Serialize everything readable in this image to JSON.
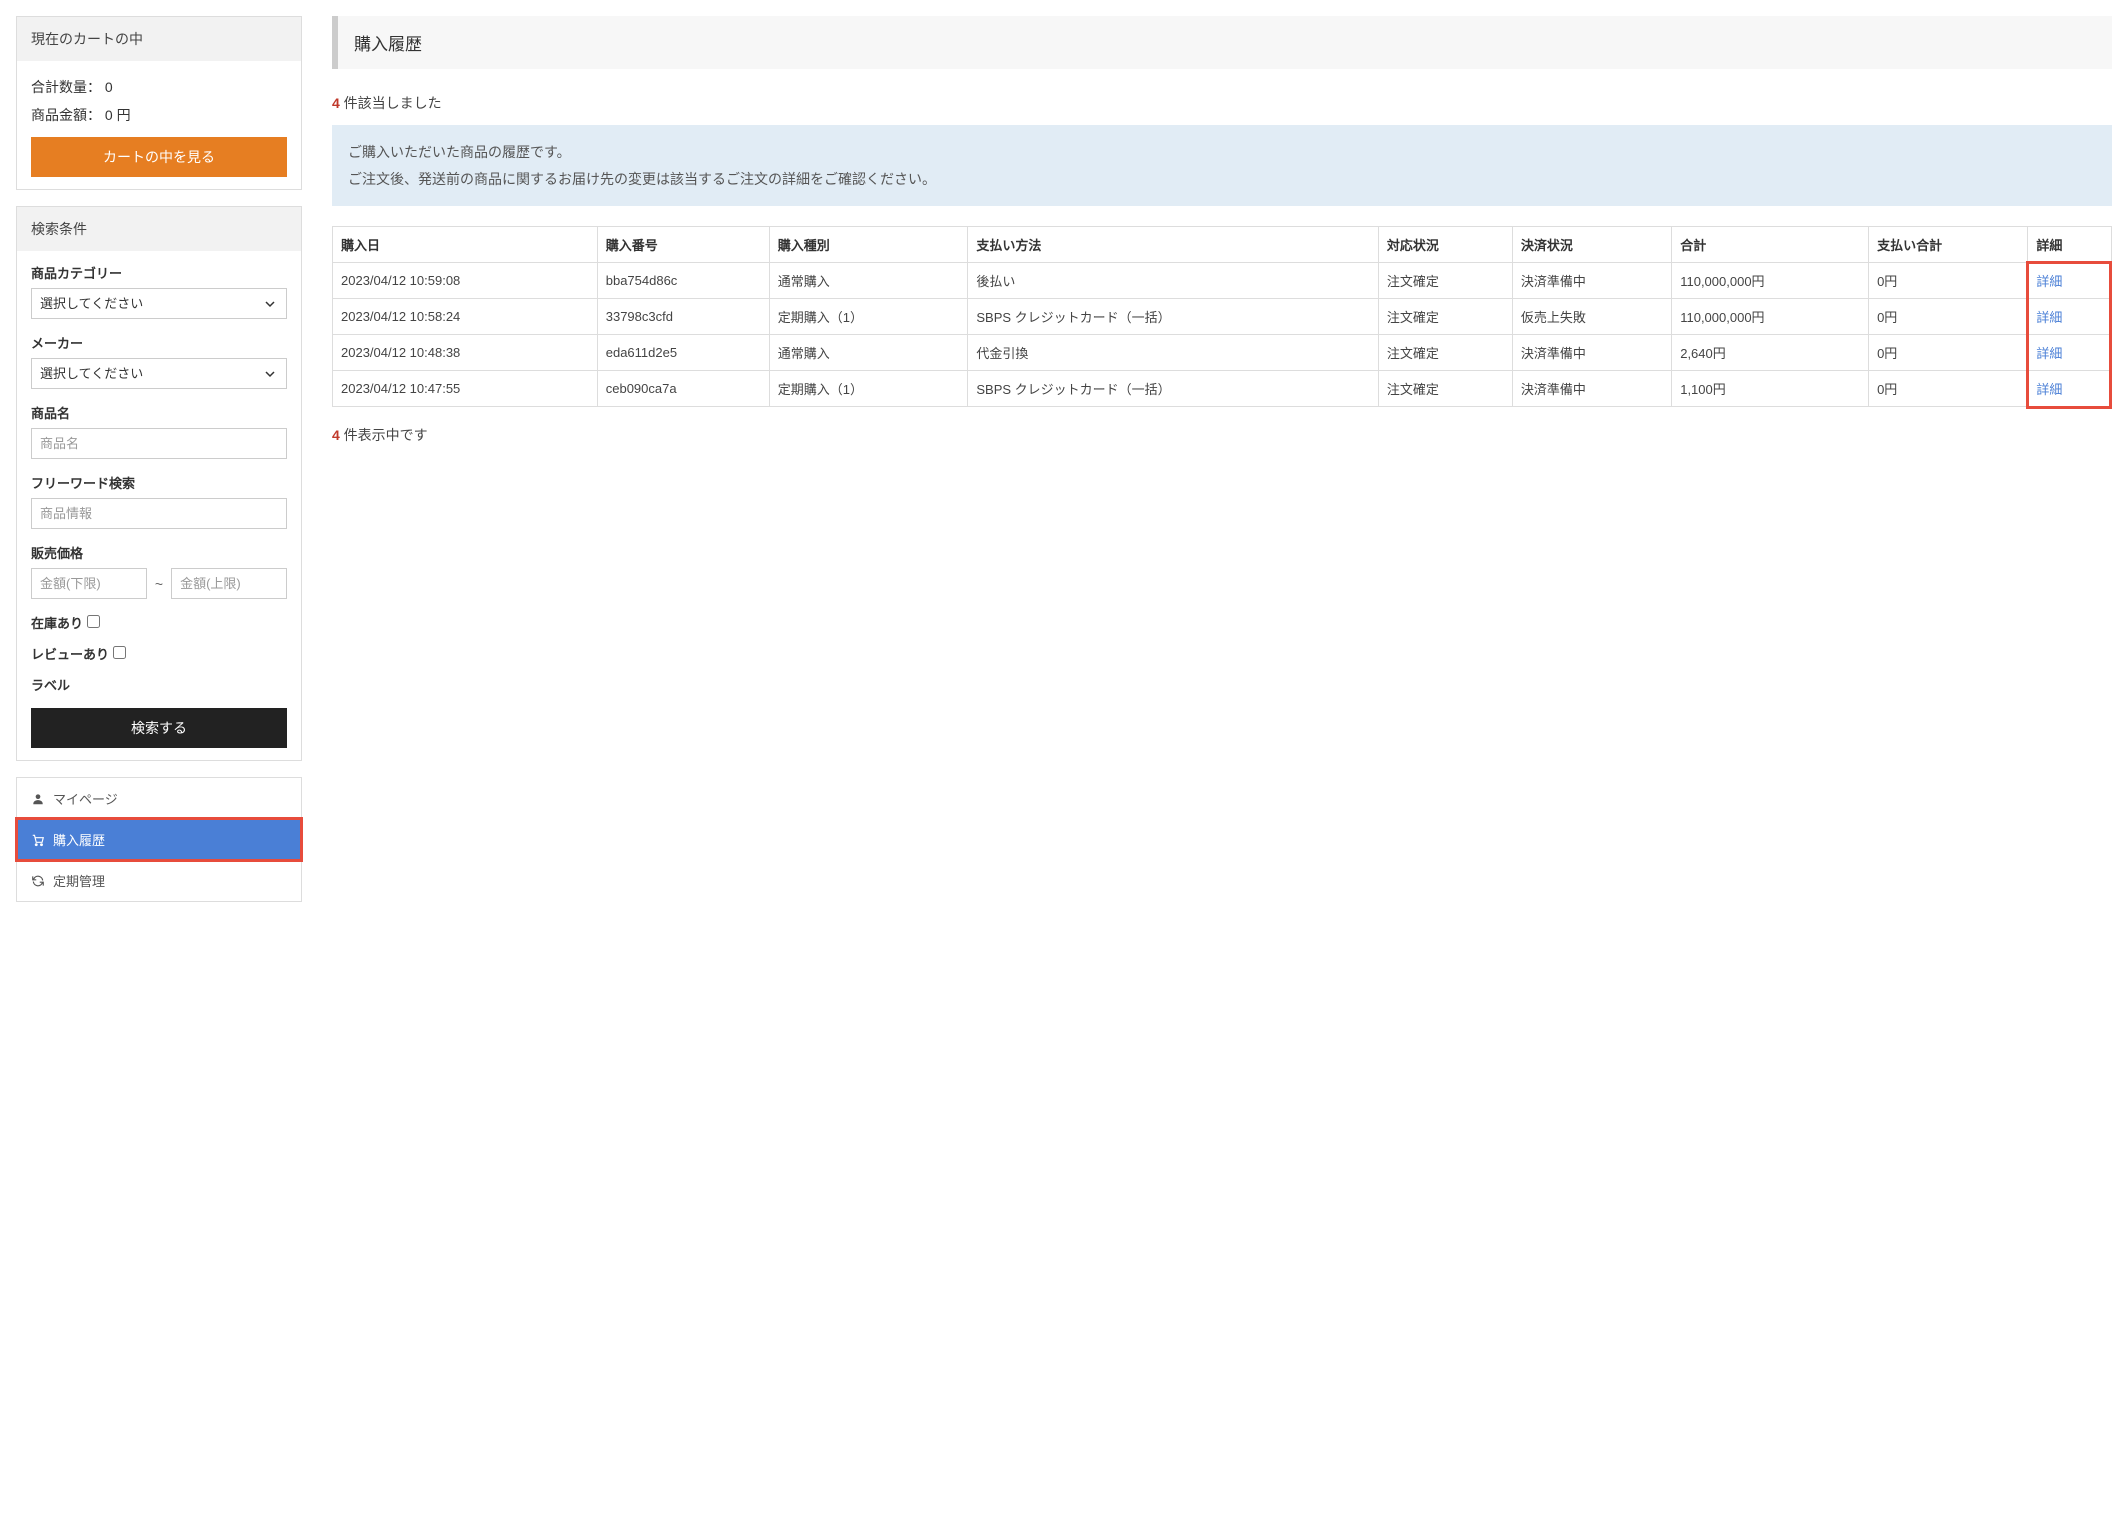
{
  "sidebar": {
    "cart": {
      "header": "現在のカートの中",
      "qty_label": "合計数量： 0",
      "amount_label": "商品金額： 0 円",
      "button": "カートの中を見る"
    },
    "search": {
      "header": "検索条件",
      "category_label": "商品カテゴリー",
      "category_placeholder": "選択してください",
      "maker_label": "メーカー",
      "maker_placeholder": "選択してください",
      "name_label": "商品名",
      "name_placeholder": "商品名",
      "freeword_label": "フリーワード検索",
      "freeword_placeholder": "商品情報",
      "price_label": "販売価格",
      "price_min_placeholder": "金額(下限)",
      "price_max_placeholder": "金額(上限)",
      "stock_label": "在庫あり",
      "review_label": "レビューあり",
      "label_label": "ラベル",
      "submit": "検索する"
    },
    "nav": {
      "mypage": "マイページ",
      "history": "購入履歴",
      "subscription": "定期管理"
    }
  },
  "main": {
    "title": "購入履歴",
    "count_num": "4",
    "count_suffix": " 件該当しました",
    "info_line1": "ご購入いただいた商品の履歴です。",
    "info_line2": "ご注文後、発送前の商品に関するお届け先の変更は該当するご注文の詳細をご確認ください。",
    "after_count_num": "4",
    "after_count_suffix": " 件表示中です",
    "table": {
      "headers": [
        "購入日",
        "購入番号",
        "購入種別",
        "支払い方法",
        "対応状況",
        "決済状況",
        "合計",
        "支払い合計",
        "詳細"
      ],
      "rows": [
        {
          "date": "2023/04/12 10:59:08",
          "num": "bba754d86c",
          "type": "通常購入",
          "method": "後払い",
          "status": "注文確定",
          "pay_status": "決済準備中",
          "total": "110,000,000円",
          "paid": "0円",
          "detail": "詳細"
        },
        {
          "date": "2023/04/12 10:58:24",
          "num": "33798c3cfd",
          "type": "定期購入（1）",
          "method": "SBPS クレジットカード（一括）",
          "status": "注文確定",
          "pay_status": "仮売上失敗",
          "total": "110,000,000円",
          "paid": "0円",
          "detail": "詳細"
        },
        {
          "date": "2023/04/12 10:48:38",
          "num": "eda611d2e5",
          "type": "通常購入",
          "method": "代金引換",
          "status": "注文確定",
          "pay_status": "決済準備中",
          "total": "2,640円",
          "paid": "0円",
          "detail": "詳細"
        },
        {
          "date": "2023/04/12 10:47:55",
          "num": "ceb090ca7a",
          "type": "定期購入（1）",
          "method": "SBPS クレジットカード（一括）",
          "status": "注文確定",
          "pay_status": "決済準備中",
          "total": "1,100円",
          "paid": "0円",
          "detail": "詳細"
        }
      ]
    }
  }
}
